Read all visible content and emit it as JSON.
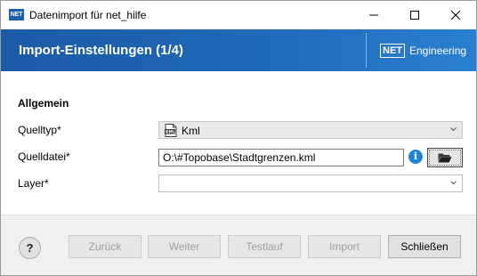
{
  "window": {
    "title": "Datenimport für net_hilfe",
    "app_icon_text": "NET"
  },
  "header": {
    "title": "Import-Einstellungen (1/4)",
    "brand_box": "NET",
    "brand_name": "Engineering"
  },
  "section": {
    "title": "Allgemein"
  },
  "fields": {
    "quelltyp_label": "Quelltyp*",
    "quelltyp_value": "Kml",
    "quelldatei_label": "Quelldatei*",
    "quelldatei_value": "O:\\#Topobase\\Stadtgrenzen.kml",
    "layer_label": "Layer*",
    "layer_value": ""
  },
  "footer": {
    "help_label": "?",
    "back_label": "Zurück",
    "next_label": "Weiter",
    "testrun_label": "Testlauf",
    "import_label": "Import",
    "close_label": "Schließen"
  },
  "colors": {
    "banner": "#1b5aa6",
    "info": "#1e86d8",
    "window_bg": "#f0f0f0"
  },
  "icons": {
    "app": "net-logo-icon",
    "kml": "kml-file-icon",
    "info": "info-icon",
    "browse": "folder-open-icon",
    "dropdown": "chevron-down-icon"
  }
}
